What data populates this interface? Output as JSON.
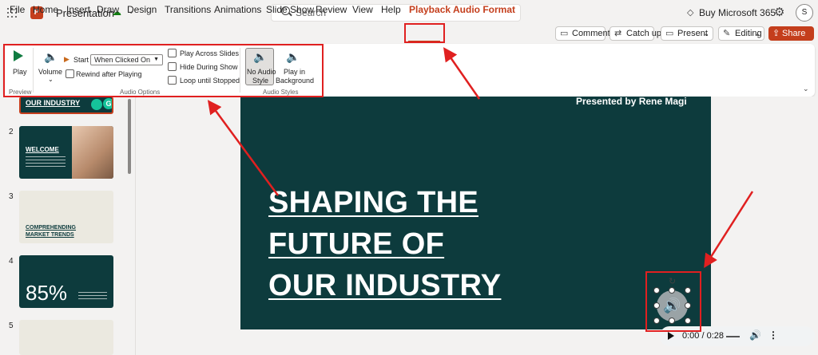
{
  "titlebar": {
    "app_logo": "P",
    "doc_title": "Presentation",
    "search_placeholder": "Search",
    "buy_label": "Buy Microsoft 365",
    "avatar_initial": "S"
  },
  "tabs": [
    "File",
    "Home",
    "Insert",
    "Draw",
    "Design",
    "Transitions",
    "Animations",
    "Slide Show",
    "Review",
    "View",
    "Help",
    "Playback",
    "Audio Format"
  ],
  "active_tab": "Playback",
  "right_buttons": {
    "comments": "Comments",
    "catchup": "Catch up",
    "present": "Present",
    "editing": "Editing",
    "share": "Share"
  },
  "ribbon": {
    "preview": {
      "play": "Play",
      "group": "Preview"
    },
    "audio_options": {
      "volume": "Volume",
      "start_label": "Start",
      "start_value": "When Clicked On",
      "rewind": "Rewind after Playing",
      "play_across": "Play Across Slides",
      "hide_during": "Hide During Show",
      "loop": "Loop until Stopped",
      "group": "Audio Options"
    },
    "audio_styles": {
      "no_style_1": "No Audio",
      "no_style_2": "Style",
      "play_bg_1": "Play in",
      "play_bg_2": "Background",
      "group": "Audio Styles"
    }
  },
  "thumbnails": {
    "t1_title": "OUR INDUSTRY",
    "t2_num": "2",
    "t2_title": "WELCOME",
    "t3_num": "3",
    "t3_line1": "COMPREHENDING",
    "t3_line2": "MARKET TRENDS",
    "t4_num": "4",
    "t4_big": "85%",
    "t5_num": "5"
  },
  "slide": {
    "subtitle": "Presented by Rene Magi",
    "line1": "SHAPING THE",
    "line2": "FUTURE OF",
    "line3": "OUR INDUSTRY"
  },
  "player": {
    "time": "0:00 / 0:28"
  },
  "colors": {
    "accent": "#c43e1c",
    "slide_bg": "#0d3b3d",
    "annotation": "#e02020"
  }
}
